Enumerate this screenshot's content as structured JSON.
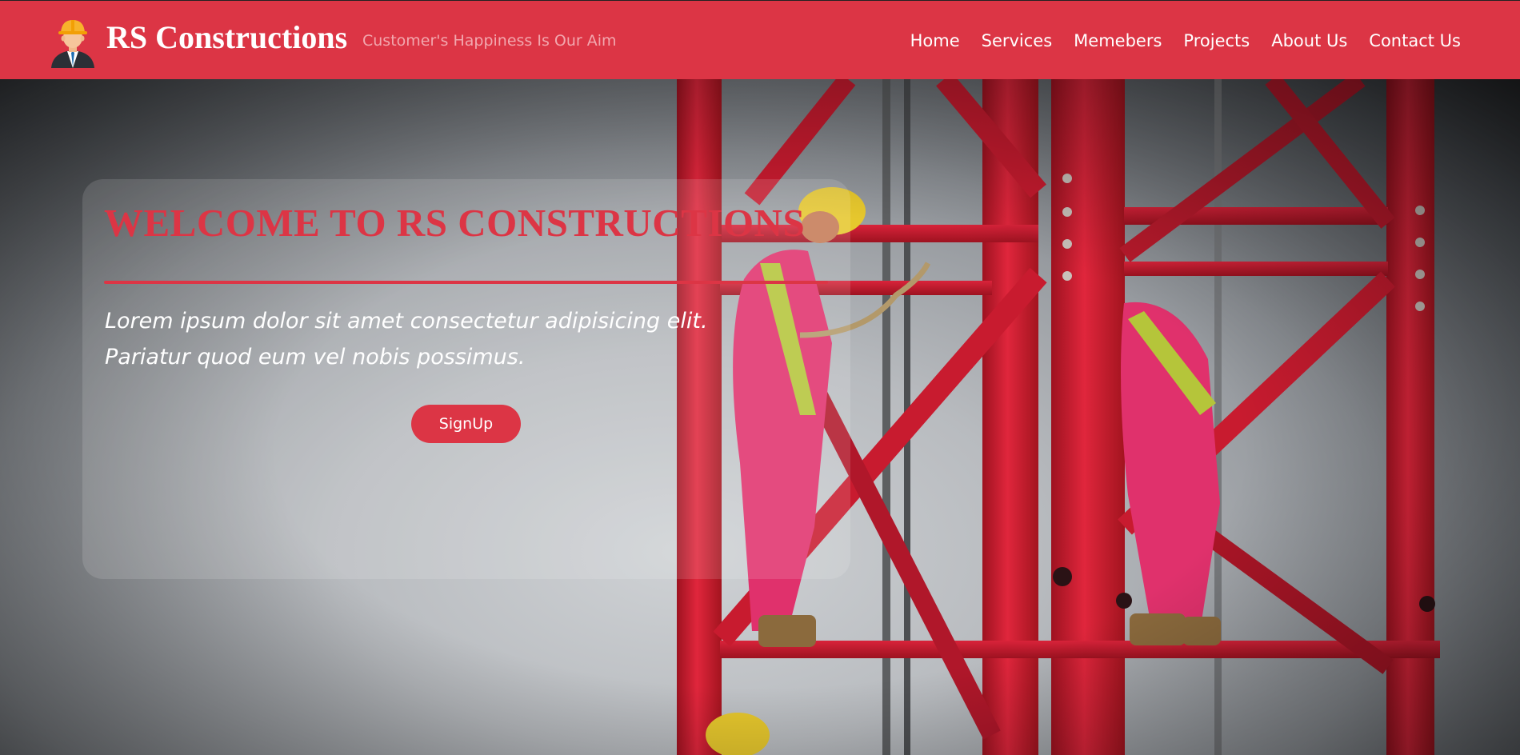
{
  "brand": {
    "name": "RS Constructions",
    "tagline": "Customer's Happiness Is Our Aim",
    "logo_icon": "construction-worker-avatar-icon"
  },
  "nav": {
    "items": [
      {
        "label": "Home"
      },
      {
        "label": "Services"
      },
      {
        "label": "Memebers"
      },
      {
        "label": "Projects"
      },
      {
        "label": "About Us"
      },
      {
        "label": "Contact Us"
      }
    ]
  },
  "hero": {
    "title": "WELCOME TO RS CONSTRUCTIONS",
    "text": "Lorem ipsum dolor sit amet consectetur adipisicing elit. Pariatur quod eum vel nobis possimus.",
    "signup_label": "SignUp",
    "background_image": "red-crane-tower-workers-photo"
  },
  "colors": {
    "accent": "#dc3545",
    "nav_text": "#ffffff",
    "tagline": "#f2a7ae",
    "hero_text": "#ffffff"
  }
}
